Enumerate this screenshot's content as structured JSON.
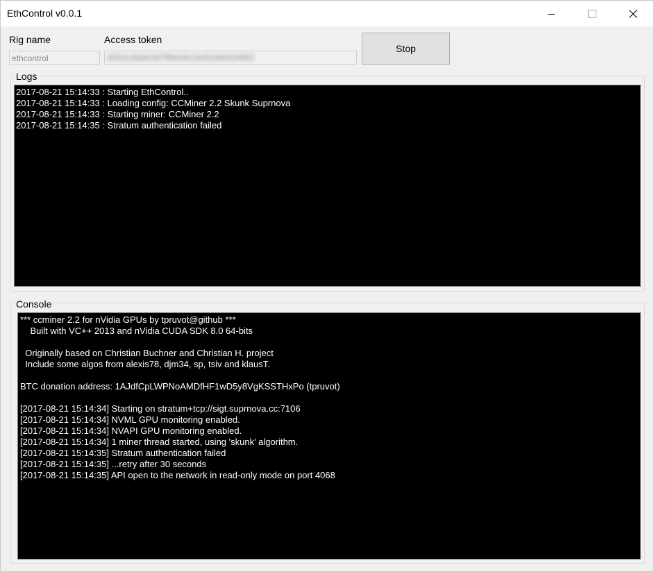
{
  "window": {
    "title": "EthControl v0.0.1"
  },
  "rig": {
    "label": "Rig name",
    "value": "ethcontrol"
  },
  "token": {
    "label": "Access token",
    "value": "4f2b1c8a9e3d7f6b0a5c2e91d4e024655"
  },
  "stop_button": {
    "label": "Stop"
  },
  "logs": {
    "label": "Logs",
    "lines": [
      "2017-08-21 15:14:33 : Starting EthControl..",
      "2017-08-21 15:14:33 : Loading config: CCMiner 2.2 Skunk Suprnova",
      "2017-08-21 15:14:33 : Starting miner: CCMiner 2.2",
      "2017-08-21 15:14:35 : Stratum authentication failed"
    ]
  },
  "console": {
    "label": "Console",
    "lines": [
      "*** ccminer 2.2 for nVidia GPUs by tpruvot@github ***",
      "    Built with VC++ 2013 and nVidia CUDA SDK 8.0 64-bits",
      "",
      "  Originally based on Christian Buchner and Christian H. project",
      "  Include some algos from alexis78, djm34, sp, tsiv and klausT.",
      "",
      "BTC donation address: 1AJdfCpLWPNoAMDfHF1wD5y8VgKSSTHxPo (tpruvot)",
      "",
      "[2017-08-21 15:14:34] Starting on stratum+tcp://sigt.suprnova.cc:7106",
      "[2017-08-21 15:14:34] NVML GPU monitoring enabled.",
      "[2017-08-21 15:14:34] NVAPI GPU monitoring enabled.",
      "[2017-08-21 15:14:34] 1 miner thread started, using 'skunk' algorithm.",
      "[2017-08-21 15:14:35] Stratum authentication failed",
      "[2017-08-21 15:14:35] ...retry after 30 seconds",
      "[2017-08-21 15:14:35] API open to the network in read-only mode on port 4068"
    ]
  },
  "icons": {
    "minimize": "minimize-icon",
    "maximize": "maximize-icon",
    "close": "close-icon"
  }
}
